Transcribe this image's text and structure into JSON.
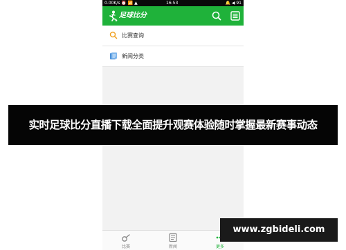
{
  "status_bar": {
    "left": "0.00K/s ⏰ 📶 ▲",
    "time": "16:53",
    "right": "🔔 ◀ 91"
  },
  "header": {
    "app_title": "足球比分",
    "logo_icon": "soccer-player-icon",
    "search_icon": "search-icon",
    "list_icon": "list-icon"
  },
  "menu": {
    "items": [
      {
        "label": "比赛查询",
        "icon": "search-icon"
      },
      {
        "label": "新闻分类",
        "icon": "news-category-icon"
      }
    ]
  },
  "tabs": [
    {
      "label": "比赛",
      "icon": "whistle-icon",
      "active": false
    },
    {
      "label": "新闻",
      "icon": "newspaper-icon",
      "active": false
    },
    {
      "label": "更多",
      "icon": "more-dots-icon",
      "active": true
    }
  ],
  "banner": {
    "text": "实时足球比分直播下载全面提升观赛体验随时掌握最新赛事动态"
  },
  "watermark": {
    "text": "www.zgbideli.com"
  },
  "colors": {
    "accent": "#1fb23a",
    "statusbar": "#0a0a0a",
    "banner_bg": "#050505"
  }
}
